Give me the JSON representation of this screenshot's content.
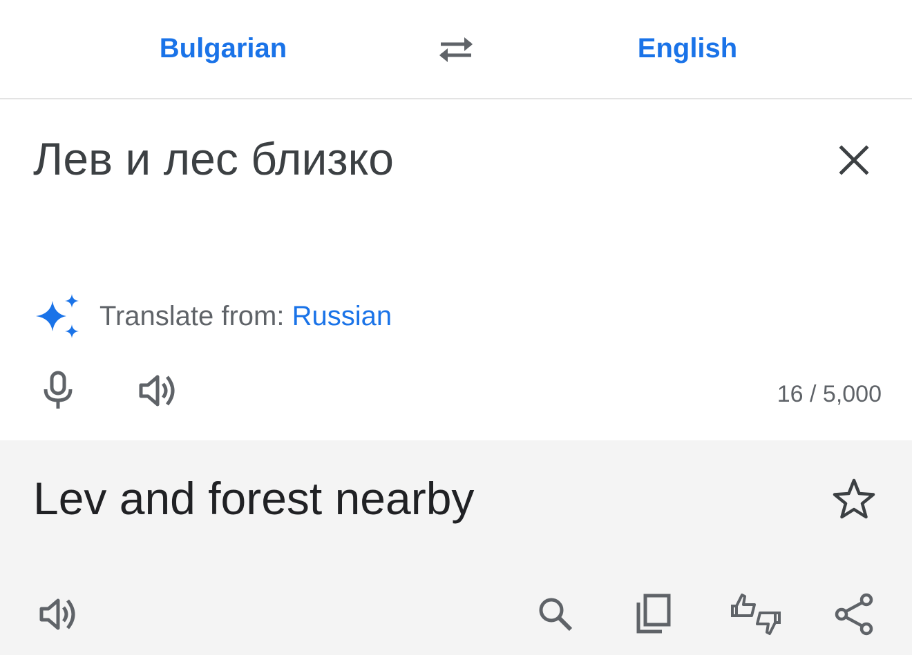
{
  "header": {
    "source_language": "Bulgarian",
    "target_language": "English",
    "swap_icon": "swap-horiz-icon"
  },
  "input": {
    "text": "Лев и лес близко",
    "clear_icon": "close-icon",
    "detect_label": "Translate from: ",
    "detected_language": "Russian",
    "sparkle_icon": "sparkle-icon",
    "mic_icon": "microphone-icon",
    "speak_icon": "speaker-icon",
    "char_count": "16 / 5,000"
  },
  "output": {
    "text": "Lev and forest nearby",
    "star_icon": "star-outline-icon",
    "speak_icon": "speaker-icon",
    "search_icon": "search-icon",
    "copy_icon": "copy-icon",
    "feedback_icon": "thumbs-up-down-icon",
    "share_icon": "share-icon"
  },
  "colors": {
    "accent": "#1a73e8",
    "icon": "#5f6368",
    "output_background": "#f4f4f4"
  }
}
